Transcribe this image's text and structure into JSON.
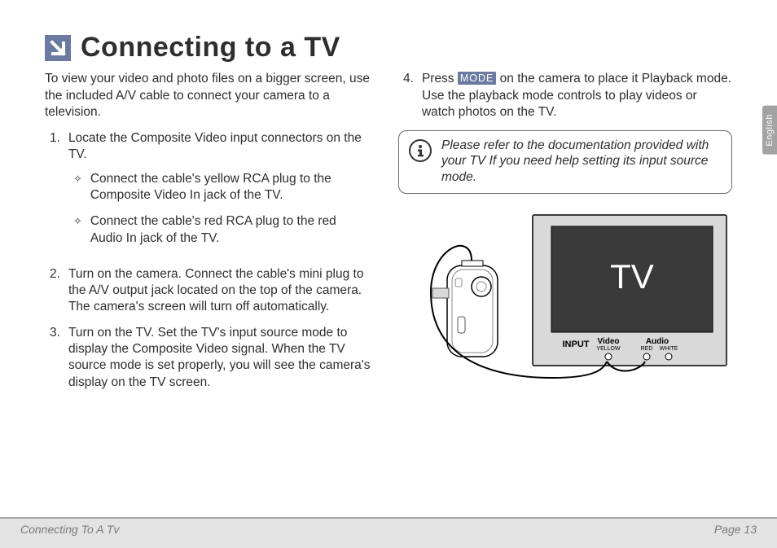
{
  "title": "Connecting to a TV",
  "intro": "To view your video and photo files on a bigger screen, use the included A/V cable to connect your camera to a television.",
  "left_list": {
    "item1": {
      "num": "1.",
      "text": "Locate the Composite Video input connectors on the TV.",
      "sub1": "Connect the cable's yellow RCA plug to the Composite Video In jack of the TV.",
      "sub2": "Connect the cable's red RCA plug to the red Audio In jack of the TV."
    },
    "item2": {
      "num": "2.",
      "text": "Turn on the camera. Connect the cable's mini plug to the A/V output jack located on the top of the camera. The camera's screen will turn off automatically."
    },
    "item3": {
      "num": "3.",
      "text": "Turn on the TV. Set the TV's input source mode to display the Composite Video signal. When the TV source mode is set properly, you will see the camera's display on the TV screen."
    }
  },
  "right_list": {
    "item4": {
      "num": "4.",
      "pre": "Press ",
      "button": "MODE",
      "post": " on the camera to place it Playback mode. Use the playback mode controls to play videos or watch photos on the TV."
    }
  },
  "info_note": "Please refer to the documentation provided with your TV If you need help setting its input source mode.",
  "diagram": {
    "tv_label": "TV",
    "input_label": "INPUT",
    "video_label": "Video",
    "audio_label": "Audio",
    "yellow_label": "YELLOW",
    "red_label": "RED",
    "white_label": "WHITE"
  },
  "lang_tab": "English",
  "footer": {
    "section": "Connecting To A Tv",
    "page": "Page 13"
  }
}
